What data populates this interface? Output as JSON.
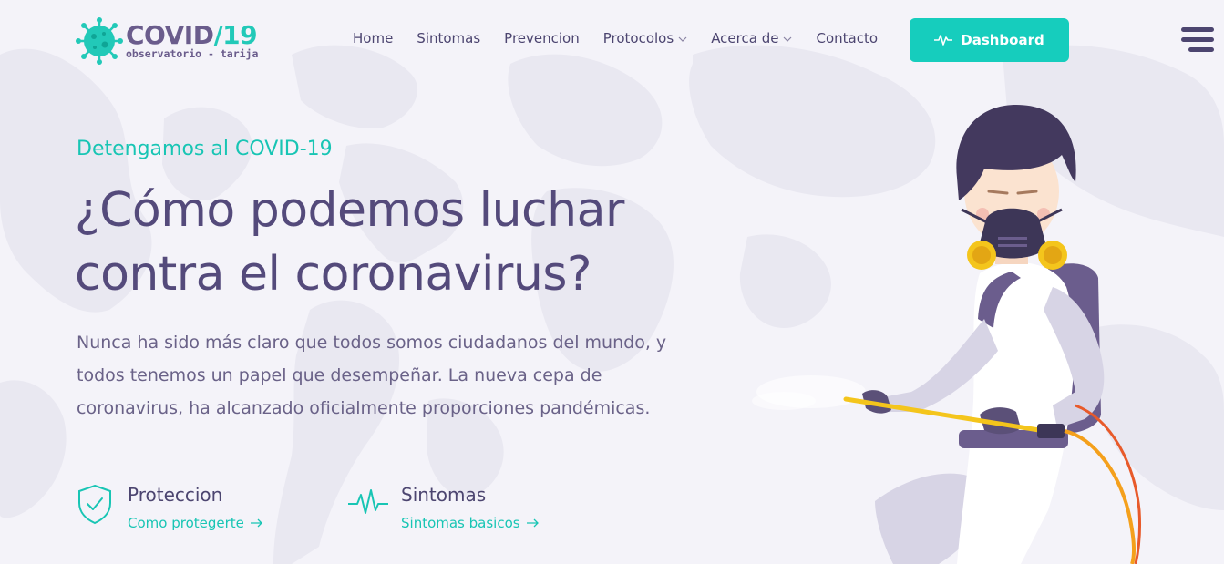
{
  "logo": {
    "title_main": "COVID",
    "title_slash": "/",
    "title_num": "19",
    "subtitle": "observatorio - tarija",
    "icon": "virus-icon"
  },
  "nav": {
    "items": [
      {
        "label": "Home",
        "has_dropdown": false
      },
      {
        "label": "Sintomas",
        "has_dropdown": false
      },
      {
        "label": "Prevencion",
        "has_dropdown": false
      },
      {
        "label": "Protocolos",
        "has_dropdown": true
      },
      {
        "label": "Acerca de",
        "has_dropdown": true
      },
      {
        "label": "Contacto",
        "has_dropdown": false
      }
    ],
    "dashboard_label": "Dashboard",
    "dashboard_icon": "pulse-icon",
    "menu_icon": "hamburger-icon"
  },
  "hero": {
    "kicker": "Detengamos al COVID-19",
    "headline_line1": "¿Cómo podemos luchar",
    "headline_line2": "contra el coronavirus?",
    "description": "Nunca ha sido más claro que todos somos ciudadanos del mundo, y todos tenemos un papel que desempeñar. La nueva cepa de coronavirus, ha alcanzado oficialmente proporciones pandémicas."
  },
  "features": [
    {
      "title": "Proteccion",
      "link": "Como protegerte",
      "icon": "shield-check-icon"
    },
    {
      "title": "Sintomas",
      "link": "Sintomas basicos",
      "icon": "pulse-icon"
    }
  ],
  "colors": {
    "accent": "#16cdbd",
    "text_dark": "#544a7b",
    "background": "#f4f3f9"
  }
}
